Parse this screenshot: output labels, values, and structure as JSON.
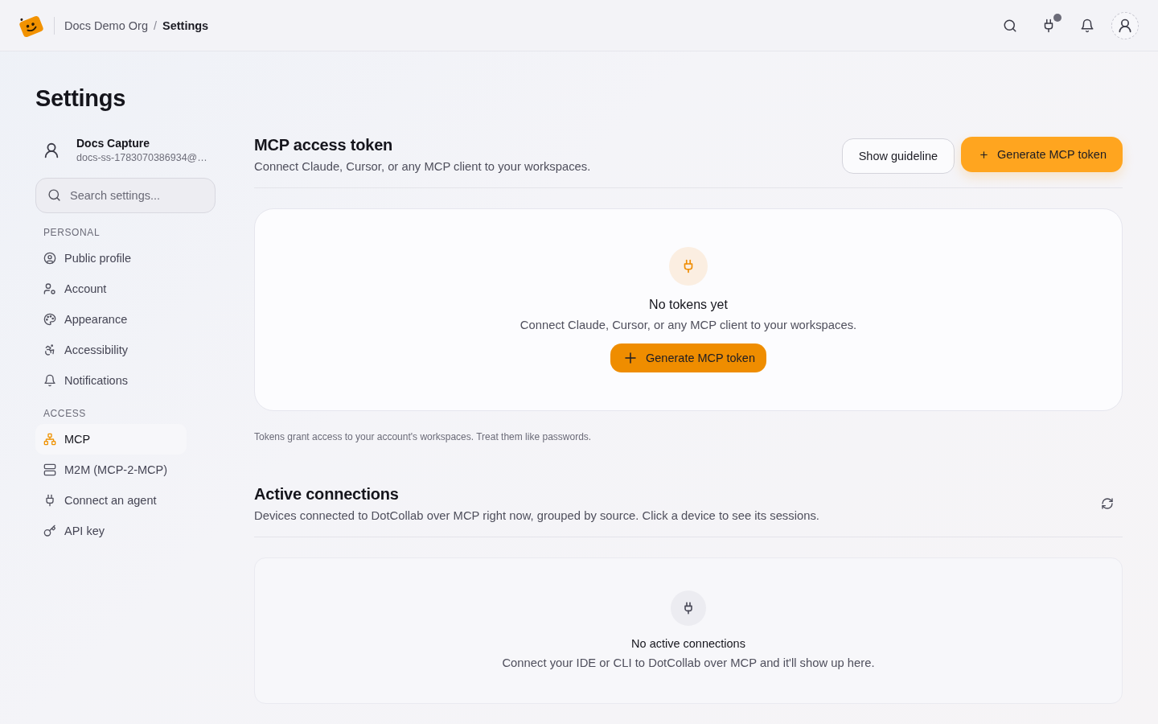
{
  "header": {
    "breadcrumb": {
      "parent": "Docs Demo Org",
      "separator": "/",
      "current": "Settings"
    },
    "connections_indicator": true
  },
  "page_title": "Settings",
  "sidebar": {
    "user": {
      "name": "Docs Capture",
      "email": "docs-ss-1783070386934@…"
    },
    "search": {
      "placeholder": "Search settings..."
    },
    "sections": [
      {
        "title": "PERSONAL",
        "items": [
          {
            "label": "Public profile",
            "selected": false
          },
          {
            "label": "Account",
            "selected": false
          },
          {
            "label": "Appearance",
            "selected": false
          },
          {
            "label": "Accessibility",
            "selected": false
          },
          {
            "label": "Notifications",
            "selected": false
          }
        ]
      },
      {
        "title": "ACCESS",
        "items": [
          {
            "label": "MCP",
            "selected": true
          },
          {
            "label": "M2M (MCP-2-MCP)",
            "selected": false
          },
          {
            "label": "Connect an agent",
            "selected": false
          },
          {
            "label": "API key",
            "selected": false
          }
        ]
      }
    ]
  },
  "token_section": {
    "title": "MCP access token",
    "description": "Connect Claude, Cursor, or any MCP client to your workspaces.",
    "guideline_button": "Show guideline",
    "generate_button": "Generate MCP token",
    "empty_state": {
      "title": "No tokens yet",
      "text": "Connect Claude, Cursor, or any MCP client to your workspaces.",
      "button": "Generate MCP token"
    },
    "note": "Tokens grant access to your account's workspaces. Treat them like passwords."
  },
  "connections_section": {
    "title": "Active connections",
    "description": "Devices connected to DotCollab over MCP right now, grouped by source. Click a device to see its sessions.",
    "empty_state": {
      "title": "No active connections",
      "text": "Connect your IDE or CLI to DotCollab over MCP and it'll show up here."
    }
  }
}
